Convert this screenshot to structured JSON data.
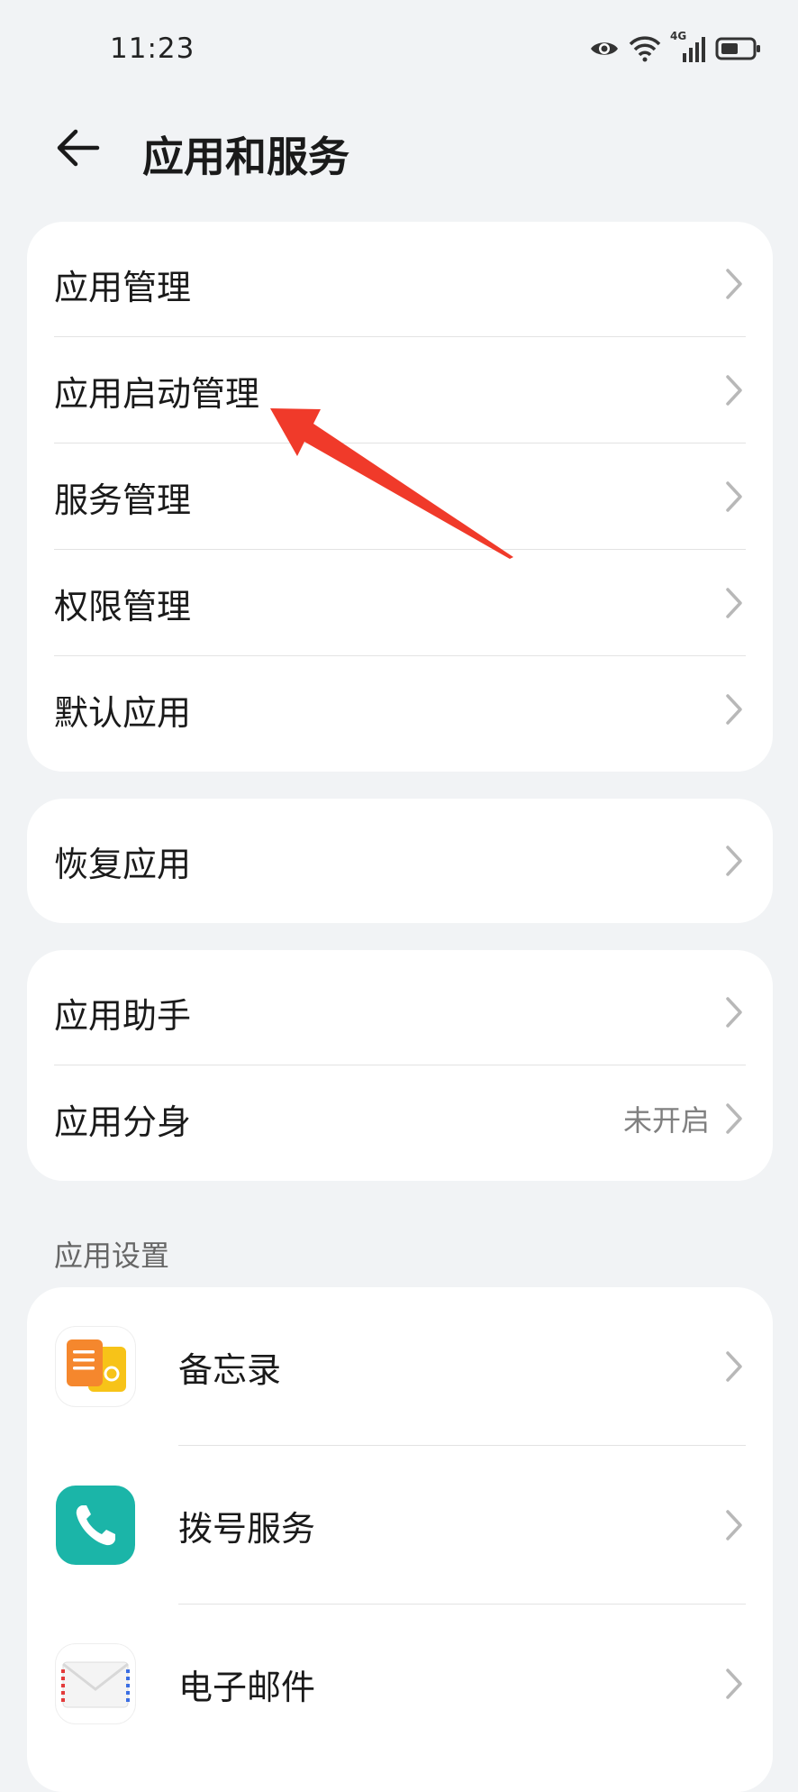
{
  "status": {
    "time": "11:23",
    "network": "4G"
  },
  "header": {
    "title": "应用和服务"
  },
  "card1": {
    "items": [
      {
        "label": "应用管理"
      },
      {
        "label": "应用启动管理"
      },
      {
        "label": "服务管理"
      },
      {
        "label": "权限管理"
      },
      {
        "label": "默认应用"
      }
    ]
  },
  "card2": {
    "items": [
      {
        "label": "恢复应用"
      }
    ]
  },
  "card3": {
    "items": [
      {
        "label": "应用助手",
        "value": ""
      },
      {
        "label": "应用分身",
        "value": "未开启"
      }
    ]
  },
  "app_settings": {
    "header": "应用设置",
    "apps": [
      {
        "label": "备忘录",
        "icon": "memo-icon"
      },
      {
        "label": "拨号服务",
        "icon": "phone-icon"
      },
      {
        "label": "电子邮件",
        "icon": "email-icon"
      }
    ]
  },
  "colors": {
    "accent_red": "#f03a2a",
    "phone_teal": "#1bb5a8",
    "memo_orange": "#f5872d",
    "memo_yellow": "#f7c318"
  }
}
